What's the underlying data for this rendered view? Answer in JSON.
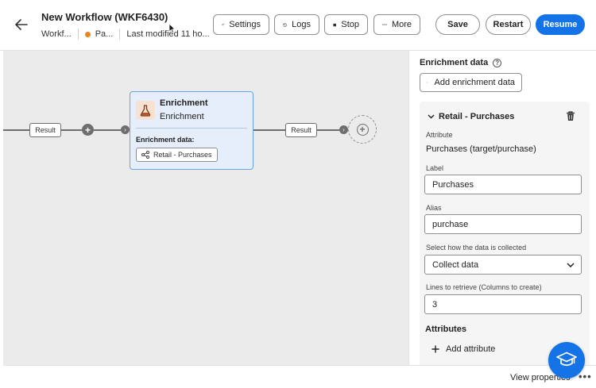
{
  "header": {
    "title": "New Workflow (WKF6430)",
    "breadcrumb_workflow": "Workf...",
    "status_text": "Pa...",
    "status_color": "#e68619",
    "last_modified": "Last modified 11 ho..."
  },
  "toolbar": {
    "settings_label": "Settings",
    "logs_label": "Logs",
    "stop_label": "Stop",
    "more_label": "More",
    "save_label": "Save",
    "restart_label": "Restart",
    "resume_label": "Resume"
  },
  "canvas": {
    "result_left_label": "Result",
    "result_right_label": "Result",
    "node": {
      "title": "Enrichment",
      "subtitle": "Enrichment",
      "data_label": "Enrichment data:",
      "tag_label": "Retail - Purchases"
    }
  },
  "panel": {
    "heading": "Enrichment data",
    "add_enrichment_label": "Add enrichment data",
    "card": {
      "title": "Retail - Purchases",
      "attribute_label": "Attribute",
      "attribute_value": "Purchases (target/purchase)",
      "label_label": "Label",
      "label_value": "Purchases",
      "alias_label": "Alias",
      "alias_value": "purchase",
      "collect_label": "Select how the data is collected",
      "collect_value": "Collect data",
      "lines_label": "Lines to retrieve (Columns to create)",
      "lines_value": "3"
    },
    "attributes_heading": "Attributes",
    "add_attribute_label": "Add attribute"
  },
  "footer": {
    "view_properties_label": "View properties",
    "more_dots": "•••"
  },
  "colors": {
    "accent": "#1473e6",
    "node_bg": "#e5eefa",
    "node_border": "#6ba2e6",
    "canvas_bg": "#ebebeb"
  }
}
